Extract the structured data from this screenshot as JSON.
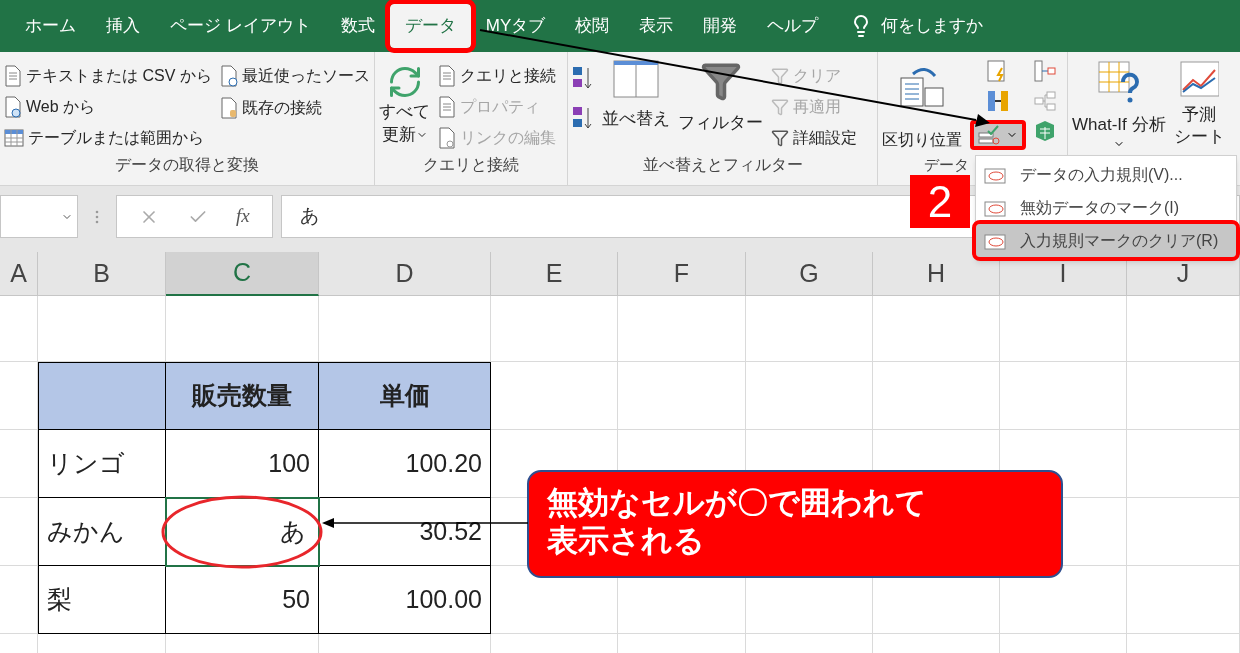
{
  "tabs": [
    {
      "label": "ホーム",
      "selected": false
    },
    {
      "label": "挿入",
      "selected": false
    },
    {
      "label": "ページ レイアウト",
      "selected": false
    },
    {
      "label": "数式",
      "selected": false
    },
    {
      "label": "データ",
      "selected": true
    },
    {
      "label": "MYタブ",
      "selected": false
    },
    {
      "label": "校閲",
      "selected": false
    },
    {
      "label": "表示",
      "selected": false
    },
    {
      "label": "開発",
      "selected": false
    },
    {
      "label": "ヘルプ",
      "selected": false
    }
  ],
  "tell_me": "何をしますか",
  "ribbon": {
    "get_transform": {
      "label": "データの取得と変換",
      "commands": [
        {
          "text": "テキストまたは CSV から",
          "disabled": false
        },
        {
          "text": "Web から",
          "disabled": false
        },
        {
          "text": "テーブルまたは範囲から",
          "disabled": false
        },
        {
          "text": "最近使ったソース",
          "disabled": false
        },
        {
          "text": "既存の接続",
          "disabled": false
        }
      ]
    },
    "queries": {
      "label": "クエリと接続",
      "refresh_all": {
        "lines": [
          "すべて",
          "更新"
        ]
      },
      "commands": [
        {
          "text": "クエリと接続",
          "disabled": false
        },
        {
          "text": "プロパティ",
          "disabled": true
        },
        {
          "text": "リンクの編集",
          "disabled": true
        }
      ]
    },
    "sort_filter": {
      "label": "並べ替えとフィルター",
      "sort": "並べ替え",
      "filter": "フィルター",
      "commands": [
        {
          "text": "クリア",
          "disabled": true
        },
        {
          "text": "再適用",
          "disabled": true
        },
        {
          "text": "詳細設定",
          "disabled": false
        }
      ]
    },
    "data_tools": {
      "label": "データ",
      "text_to_columns": "区切り位置",
      "validation_button": {
        "selected": true
      }
    },
    "forecast": {
      "what_if": "What-If 分析",
      "forecast_sheet": {
        "lines": [
          "予測",
          "シート"
        ]
      }
    }
  },
  "validation_menu": [
    {
      "text": "データの入力規則(V)...",
      "selected": false
    },
    {
      "text": "無効データのマーク(I)",
      "selected": false
    },
    {
      "text": "入力規則マークのクリア(R)",
      "selected": true
    }
  ],
  "step_number": "2",
  "formula_bar": {
    "function_label": "fx",
    "value": "あ"
  },
  "columns": [
    {
      "label": "A",
      "selected": false
    },
    {
      "label": "B",
      "selected": false
    },
    {
      "label": "C",
      "selected": true
    },
    {
      "label": "D",
      "selected": false
    },
    {
      "label": "E",
      "selected": false
    },
    {
      "label": "F",
      "selected": false
    },
    {
      "label": "G",
      "selected": false
    },
    {
      "label": "H",
      "selected": false
    },
    {
      "label": "I",
      "selected": false
    },
    {
      "label": "J",
      "selected": false
    }
  ],
  "table": {
    "columns": [
      "販売数量",
      "単価"
    ],
    "rows": [
      {
        "name": "リンゴ",
        "quantity": "100",
        "price": "100.20",
        "invalid": false
      },
      {
        "name": "みかん",
        "quantity": "あ",
        "price": "30.52",
        "invalid": true
      },
      {
        "name": "梨",
        "quantity": "50",
        "price": "100.00",
        "invalid": false
      }
    ]
  },
  "callout": {
    "lines": [
      "無効なセルが〇で囲われて",
      "表示される"
    ]
  }
}
